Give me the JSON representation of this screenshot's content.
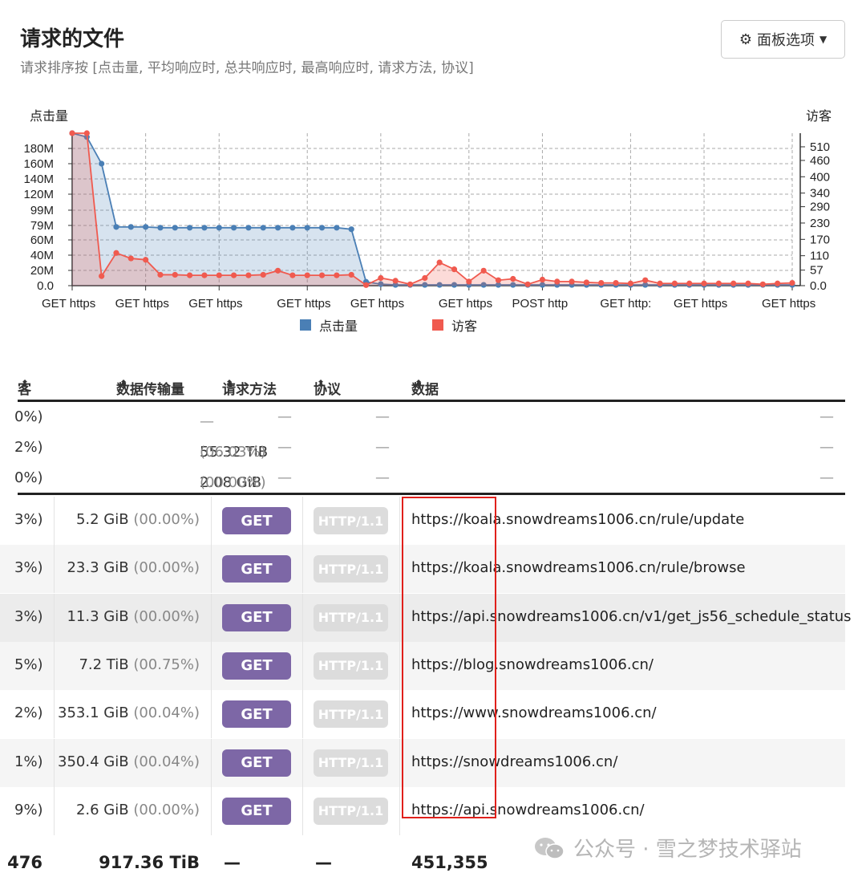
{
  "header": {
    "title": "请求的文件",
    "subtitle": "请求排序按 [点击量, 平均响应时, 总共响应时, 最高响应时, 请求方法, 协议]",
    "panel_button": "面板选项"
  },
  "chart_data": {
    "type": "area",
    "left_axis_label": "点击量",
    "right_axis_label": "访客",
    "left_ticks": [
      "0.0",
      "20M",
      "40M",
      "60M",
      "79M",
      "99M",
      "120M",
      "140M",
      "160M",
      "180M"
    ],
    "right_ticks": [
      "0.0",
      "57",
      "110",
      "170",
      "230",
      "290",
      "340",
      "400",
      "460",
      "510"
    ],
    "x_tick_labels": [
      "GET https",
      "GET https",
      "GET https",
      "GET https",
      "GET https",
      "GET https",
      "POST http",
      "GET http:",
      "GET https",
      "GET https"
    ],
    "legend": [
      "点击量",
      "访客"
    ],
    "colors": {
      "hits": "#4a7fb5",
      "visitors": "#f05a4f"
    },
    "series": [
      {
        "name": "点击量",
        "axis": "left",
        "values": [
          200,
          195,
          160,
          77,
          77,
          77,
          76,
          76,
          76,
          76,
          76,
          76,
          76,
          76,
          76,
          76,
          76,
          76,
          76,
          74,
          5,
          2,
          1,
          1,
          1,
          1,
          1,
          1,
          1,
          1,
          1,
          1,
          1,
          1,
          1,
          1,
          1,
          1,
          1,
          1,
          1,
          1,
          1,
          1,
          1,
          1,
          1,
          1,
          1,
          1
        ]
      },
      {
        "name": "访客",
        "axis": "right",
        "values": [
          560,
          560,
          35,
          120,
          100,
          95,
          40,
          40,
          38,
          38,
          38,
          38,
          38,
          40,
          55,
          38,
          38,
          38,
          38,
          40,
          2,
          28,
          18,
          5,
          28,
          85,
          60,
          15,
          55,
          20,
          25,
          5,
          22,
          15,
          15,
          12,
          10,
          10,
          8,
          20,
          8,
          8,
          8,
          8,
          8,
          8,
          8,
          5,
          8,
          10
        ]
      }
    ]
  },
  "table": {
    "headers": [
      "客",
      "数据传输量",
      "请求方法",
      "协议",
      "数据"
    ],
    "summary_rows": [
      {
        "visitors_pct": "0%)",
        "bytes": "—",
        "bytes_pct": "",
        "method": "—",
        "protocol": "—",
        "data": "—"
      },
      {
        "visitors_pct": "2%)",
        "bytes": "55.32 TiB",
        "bytes_pct": "(06.03%)",
        "method": "—",
        "protocol": "—",
        "data": "—"
      },
      {
        "visitors_pct": "0%)",
        "bytes": "2.08 GiB",
        "bytes_pct": "(00.00%)",
        "method": "—",
        "protocol": "—",
        "data": "—"
      }
    ],
    "rows": [
      {
        "visitors_pct": "3%)",
        "bytes": "5.2 GiB",
        "bytes_pct": "(00.00%)",
        "method": "GET",
        "protocol": "HTTP/1.1",
        "url": "https://koala.snowdreams1006.cn/rule/update"
      },
      {
        "visitors_pct": "3%)",
        "bytes": "23.3 GiB",
        "bytes_pct": "(00.00%)",
        "method": "GET",
        "protocol": "HTTP/1.1",
        "url": "https://koala.snowdreams1006.cn/rule/browse"
      },
      {
        "visitors_pct": "3%)",
        "bytes": "11.3 GiB",
        "bytes_pct": "(00.00%)",
        "method": "GET",
        "protocol": "HTTP/1.1",
        "url": "https://api.snowdreams1006.cn/v1/get_js56_schedule_status"
      },
      {
        "visitors_pct": "5%)",
        "bytes": "7.2 TiB",
        "bytes_pct": "(00.75%)",
        "method": "GET",
        "protocol": "HTTP/1.1",
        "url": "https://blog.snowdreams1006.cn/"
      },
      {
        "visitors_pct": "2%)",
        "bytes": "353.1 GiB",
        "bytes_pct": "(00.04%)",
        "method": "GET",
        "protocol": "HTTP/1.1",
        "url": "https://www.snowdreams1006.cn/"
      },
      {
        "visitors_pct": "1%)",
        "bytes": "350.4 GiB",
        "bytes_pct": "(00.04%)",
        "method": "GET",
        "protocol": "HTTP/1.1",
        "url": "https://snowdreams1006.cn/"
      },
      {
        "visitors_pct": "9%)",
        "bytes": "2.6 GiB",
        "bytes_pct": "(00.00%)",
        "method": "GET",
        "protocol": "HTTP/1.1",
        "url": "https://api.snowdreams1006.cn/"
      }
    ],
    "totals": {
      "visitors": "476",
      "bytes": "917.36 TiB",
      "method": "—",
      "protocol": "—",
      "data": "451,355"
    }
  },
  "watermark": "公众号 · 雪之梦技术驿站"
}
